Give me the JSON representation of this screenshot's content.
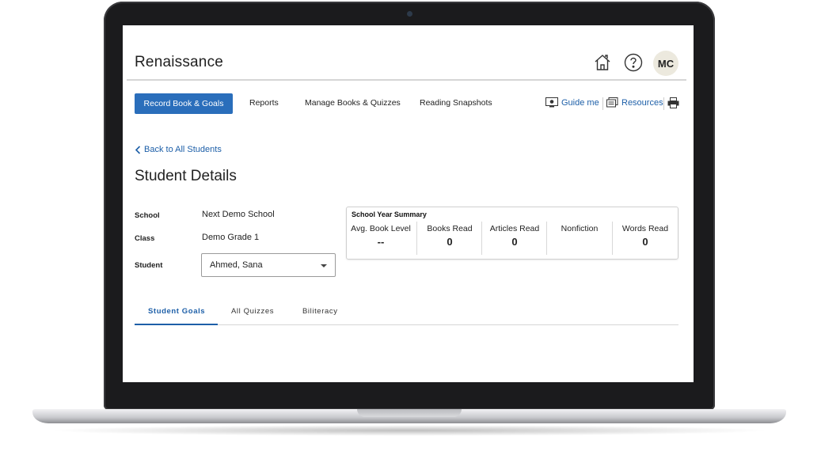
{
  "app": {
    "logo_text": "Renaissance",
    "avatar_initials": "MC",
    "accent_color": "#2a6ebb",
    "link_color": "#1d5fa8"
  },
  "header_icons": [
    "home-icon",
    "help-icon"
  ],
  "nav": {
    "items": [
      {
        "label": "Record Book & Goals",
        "active": true
      },
      {
        "label": "Reports"
      },
      {
        "label": "Manage Books & Quizzes"
      },
      {
        "label": "Reading Snapshots"
      }
    ],
    "guide_label": "Guide me",
    "resources_label": "Resources"
  },
  "back_link": "Back to All Students",
  "page_title": "Student Details",
  "details": {
    "school_label": "School",
    "school_value": "Next Demo School",
    "class_label": "Class",
    "class_value": "Demo Grade 1",
    "student_label": "Student",
    "student_value": "Ahmed, Sana"
  },
  "summary": {
    "title": "School Year Summary",
    "columns": [
      {
        "header": "Avg. Book Level",
        "value": "--"
      },
      {
        "header": "Books Read",
        "value": "0"
      },
      {
        "header": "Articles Read",
        "value": "0"
      },
      {
        "header": "Nonfiction",
        "value": ""
      },
      {
        "header": "Words Read",
        "value": "0"
      }
    ]
  },
  "tabs": [
    {
      "label": "Student Goals",
      "active": true
    },
    {
      "label": "All Quizzes"
    },
    {
      "label": "Biliteracy"
    }
  ]
}
